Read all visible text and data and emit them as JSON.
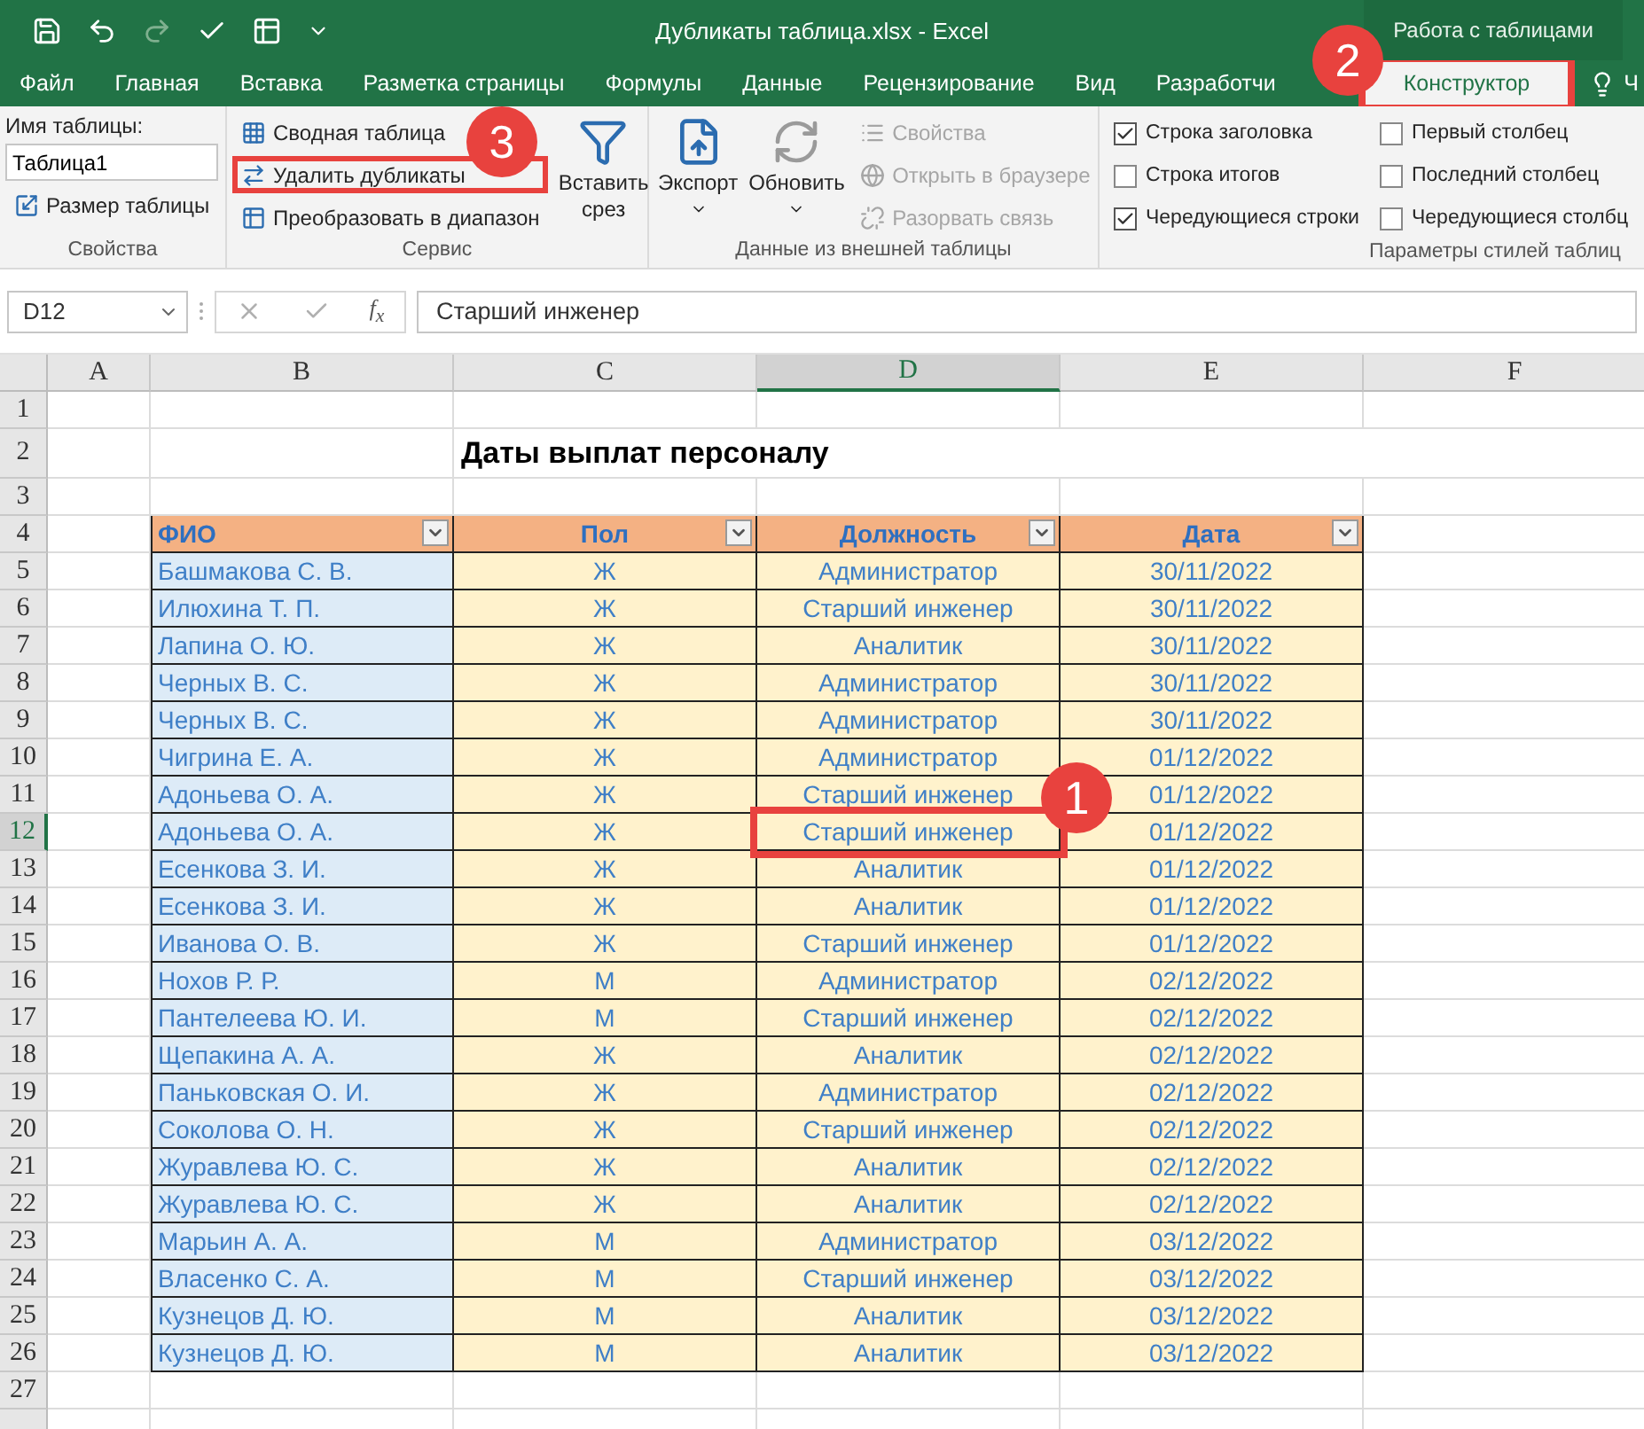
{
  "window": {
    "title": "Дубликаты таблица.xlsx - Excel",
    "context_group": "Работа с таблицами"
  },
  "tabs": [
    {
      "label": "Файл",
      "selected": false
    },
    {
      "label": "Главная",
      "selected": false
    },
    {
      "label": "Вставка",
      "selected": false
    },
    {
      "label": "Разметка страницы",
      "selected": false
    },
    {
      "label": "Формулы",
      "selected": false
    },
    {
      "label": "Данные",
      "selected": false
    },
    {
      "label": "Рецензирование",
      "selected": false
    },
    {
      "label": "Вид",
      "selected": false
    },
    {
      "label": "Разработчи",
      "selected": false
    },
    {
      "label": "Конструктор",
      "selected": true
    }
  ],
  "tell_me": "Ч",
  "ribbon": {
    "properties": {
      "label": "Свойства",
      "name_label": "Имя таблицы:",
      "name_value": "Таблица1",
      "resize": "Размер таблицы"
    },
    "tools": {
      "label": "Сервис",
      "buttons": [
        {
          "label": "Сводная таблица",
          "highlighted": false
        },
        {
          "label": "Удалить дубликаты",
          "highlighted": true
        },
        {
          "label": "Преобразовать в диапазон",
          "highlighted": false
        }
      ],
      "slicer": "Вставить срез"
    },
    "external": {
      "label": "Данные из внешней таблицы",
      "export": "Экспорт",
      "refresh": "Обновить",
      "buttons": [
        {
          "label": "Свойства",
          "disabled": true
        },
        {
          "label": "Открыть в браузере",
          "disabled": true
        },
        {
          "label": "Разорвать связь",
          "disabled": true
        }
      ]
    },
    "style_options": {
      "label": "Параметры стилей таблиц",
      "options": [
        {
          "label": "Строка заголовка",
          "checked": true
        },
        {
          "label": "Строка итогов",
          "checked": false
        },
        {
          "label": "Чередующиеся строки",
          "checked": true
        },
        {
          "label": "Первый столбец",
          "checked": false
        },
        {
          "label": "Последний столбец",
          "checked": false
        },
        {
          "label": "Чередующиеся столбц",
          "checked": false
        }
      ]
    }
  },
  "formula_bar": {
    "name_box": "D12",
    "function_label": "f$_{x}$",
    "formula": "Старший инженер"
  },
  "sheet": {
    "columns": [
      {
        "label": "A",
        "selected": false
      },
      {
        "label": "B",
        "selected": false
      },
      {
        "label": "C",
        "selected": false
      },
      {
        "label": "D",
        "selected": true
      },
      {
        "label": "E",
        "selected": false
      },
      {
        "label": "F",
        "selected": false
      }
    ],
    "rows": [
      {
        "number": "1",
        "selected": false,
        "kind": "empty"
      },
      {
        "number": "2",
        "selected": false,
        "kind": "title",
        "text": "Даты выплат персоналу"
      },
      {
        "number": "3",
        "selected": false,
        "kind": "empty"
      },
      {
        "number": "4",
        "selected": false,
        "kind": "header",
        "cells": [
          "ФИО",
          "Пол",
          "Должность",
          "Дата"
        ]
      },
      {
        "number": "5",
        "selected": false,
        "kind": "data",
        "cells": [
          "Башмакова С. В.",
          "Ж",
          "Администратор",
          "30/11/2022"
        ]
      },
      {
        "number": "6",
        "selected": false,
        "kind": "data",
        "cells": [
          "Илюхина Т. П.",
          "Ж",
          "Старший инженер",
          "30/11/2022"
        ]
      },
      {
        "number": "7",
        "selected": false,
        "kind": "data",
        "cells": [
          "Лапина О. Ю.",
          "Ж",
          "Аналитик",
          "30/11/2022"
        ]
      },
      {
        "number": "8",
        "selected": false,
        "kind": "data",
        "cells": [
          "Черных В. С.",
          "Ж",
          "Администратор",
          "30/11/2022"
        ]
      },
      {
        "number": "9",
        "selected": false,
        "kind": "data",
        "cells": [
          "Черных В. С.",
          "Ж",
          "Администратор",
          "30/11/2022"
        ]
      },
      {
        "number": "10",
        "selected": false,
        "kind": "data",
        "cells": [
          "Чигрина Е. А.",
          "Ж",
          "Администратор",
          "01/12/2022"
        ]
      },
      {
        "number": "11",
        "selected": false,
        "kind": "data",
        "cells": [
          "Адоньева О. А.",
          "Ж",
          "Старший инженер",
          "01/12/2022"
        ]
      },
      {
        "number": "12",
        "selected": true,
        "kind": "data",
        "cells": [
          "Адоньева О. А.",
          "Ж",
          "Старший инженер",
          "01/12/2022"
        ]
      },
      {
        "number": "13",
        "selected": false,
        "kind": "data",
        "cells": [
          "Есенкова З. И.",
          "Ж",
          "Аналитик",
          "01/12/2022"
        ]
      },
      {
        "number": "14",
        "selected": false,
        "kind": "data",
        "cells": [
          "Есенкова З. И.",
          "Ж",
          "Аналитик",
          "01/12/2022"
        ]
      },
      {
        "number": "15",
        "selected": false,
        "kind": "data",
        "cells": [
          "Иванова О. В.",
          "Ж",
          "Старший инженер",
          "01/12/2022"
        ]
      },
      {
        "number": "16",
        "selected": false,
        "kind": "data",
        "cells": [
          "Нохов Р. Р.",
          "М",
          "Администратор",
          "02/12/2022"
        ]
      },
      {
        "number": "17",
        "selected": false,
        "kind": "data",
        "cells": [
          "Пантелеева Ю. И.",
          "М",
          "Старший инженер",
          "02/12/2022"
        ]
      },
      {
        "number": "18",
        "selected": false,
        "kind": "data",
        "cells": [
          "Щепакина А. А.",
          "Ж",
          "Аналитик",
          "02/12/2022"
        ]
      },
      {
        "number": "19",
        "selected": false,
        "kind": "data",
        "cells": [
          "Паньковская О. И.",
          "Ж",
          "Администратор",
          "02/12/2022"
        ]
      },
      {
        "number": "20",
        "selected": false,
        "kind": "data",
        "cells": [
          "Соколова О. Н.",
          "Ж",
          "Старший инженер",
          "02/12/2022"
        ]
      },
      {
        "number": "21",
        "selected": false,
        "kind": "data",
        "cells": [
          "Журавлева Ю. С.",
          "Ж",
          "Аналитик",
          "02/12/2022"
        ]
      },
      {
        "number": "22",
        "selected": false,
        "kind": "data",
        "cells": [
          "Журавлева Ю. С.",
          "Ж",
          "Аналитик",
          "02/12/2022"
        ]
      },
      {
        "number": "23",
        "selected": false,
        "kind": "data",
        "cells": [
          "Марьин А. А.",
          "М",
          "Администратор",
          "03/12/2022"
        ]
      },
      {
        "number": "24",
        "selected": false,
        "kind": "data",
        "cells": [
          "Власенко С. А.",
          "М",
          "Старший инженер",
          "03/12/2022"
        ]
      },
      {
        "number": "25",
        "selected": false,
        "kind": "data",
        "cells": [
          "Кузнецов Д. Ю.",
          "М",
          "Аналитик",
          "03/12/2022"
        ]
      },
      {
        "number": "26",
        "selected": false,
        "kind": "data",
        "cells": [
          "Кузнецов Д. Ю.",
          "М",
          "Аналитик",
          "03/12/2022"
        ]
      },
      {
        "number": "27",
        "selected": false,
        "kind": "empty"
      }
    ]
  },
  "annotations": [
    {
      "label": "1"
    },
    {
      "label": "2"
    },
    {
      "label": "3"
    }
  ]
}
